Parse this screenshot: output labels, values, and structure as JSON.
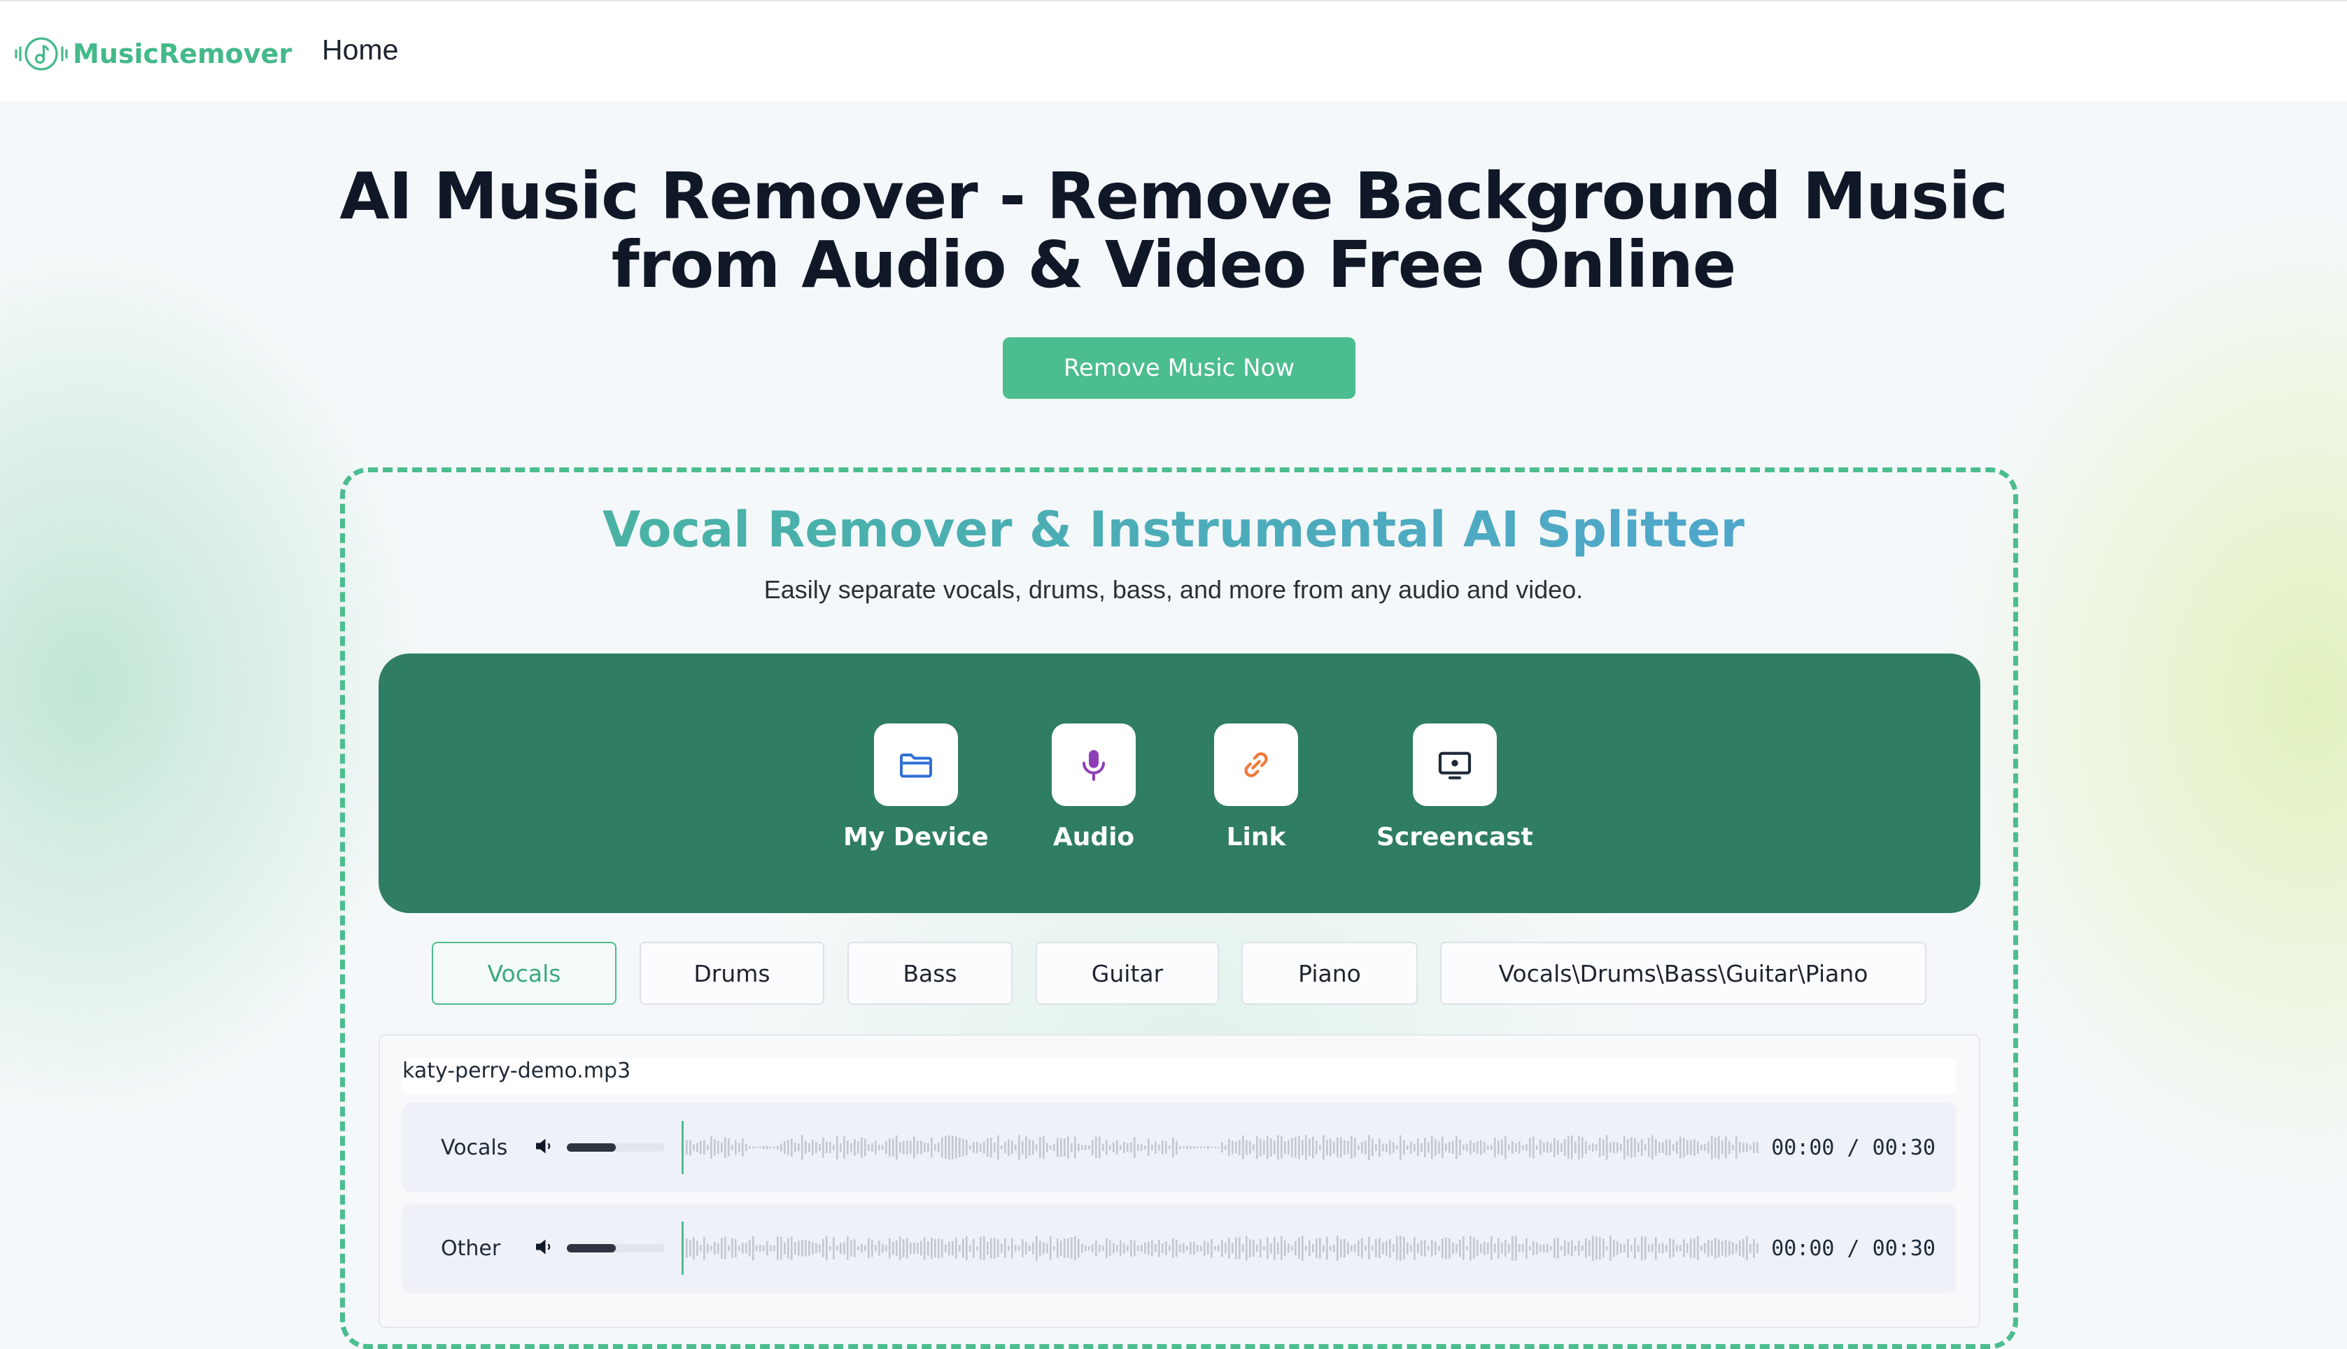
{
  "header": {
    "brand": "MusicRemover",
    "nav": [
      "Home"
    ]
  },
  "hero": {
    "title_line1": "AI Music Remover - Remove Background Music",
    "title_line2": "from Audio & Video Free Online",
    "cta_label": "Remove Music Now"
  },
  "tool": {
    "title": "Vocal Remover & Instrumental AI Splitter",
    "subtitle": "Easily separate vocals, drums, bass, and more from any audio and video.",
    "sources": [
      {
        "label": "My Device",
        "icon": "folder-icon",
        "color": "#2f6fd6"
      },
      {
        "label": "Audio",
        "icon": "microphone-icon",
        "color": "#8e3fb8"
      },
      {
        "label": "Link",
        "icon": "link-icon",
        "color": "#f07a3a"
      },
      {
        "label": "Screencast",
        "icon": "screen-record-icon",
        "color": "#1f2937"
      }
    ],
    "tabs": [
      "Vocals",
      "Drums",
      "Bass",
      "Guitar",
      "Piano",
      "Vocals\\Drums\\Bass\\Guitar\\Piano"
    ],
    "active_tab": "Vocals"
  },
  "player": {
    "file_name": "katy-perry-demo.mp3",
    "tracks": [
      {
        "label": "Vocals",
        "volume": 0.5,
        "time": "00:00 / 00:30"
      },
      {
        "label": "Other",
        "volume": 0.5,
        "time": "00:00 / 00:30"
      }
    ]
  },
  "colors": {
    "accent": "#4bbd8e",
    "panel": "#2f7d62",
    "heading": "#101828"
  }
}
